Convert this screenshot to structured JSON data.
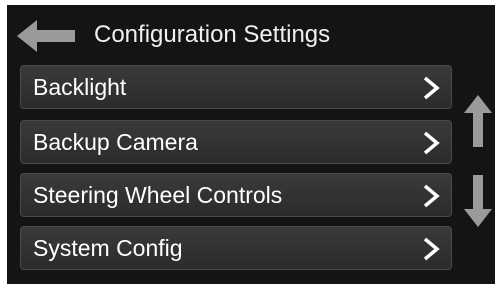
{
  "header": {
    "back_icon": "arrow-left-icon",
    "title": "Configuration Settings"
  },
  "menu": {
    "items": [
      {
        "label": "Backlight",
        "icon": "chevron-right-icon"
      },
      {
        "label": "Backup Camera",
        "icon": "chevron-right-icon"
      },
      {
        "label": "Steering Wheel Controls",
        "icon": "chevron-right-icon"
      },
      {
        "label": "System Config",
        "icon": "chevron-right-icon"
      }
    ]
  },
  "scroll": {
    "up_icon": "arrow-up-icon",
    "down_icon": "arrow-down-icon"
  },
  "colors": {
    "screen_bg": "#141414",
    "item_bg": "#333333",
    "icon_gray": "#9a9a9a",
    "text": "#ffffff"
  }
}
